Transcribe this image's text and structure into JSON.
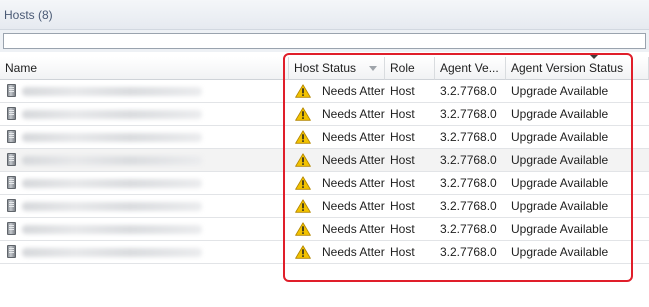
{
  "window": {
    "title": "Hosts (8)"
  },
  "search": {
    "value": "",
    "placeholder": ""
  },
  "columns": {
    "name": "Name",
    "host_status": "Host Status",
    "role": "Role",
    "agent_version": "Agent Ve...",
    "agent_version_status": "Agent Version Status"
  },
  "rows": [
    {
      "host_status": "Needs Atter",
      "role": "Host",
      "agent_version": "3.2.7768.0",
      "agent_version_status": "Upgrade Available"
    },
    {
      "host_status": "Needs Atter",
      "role": "Host",
      "agent_version": "3.2.7768.0",
      "agent_version_status": "Upgrade Available"
    },
    {
      "host_status": "Needs Atter",
      "role": "Host",
      "agent_version": "3.2.7768.0",
      "agent_version_status": "Upgrade Available"
    },
    {
      "host_status": "Needs Atter",
      "role": "Host",
      "agent_version": "3.2.7768.0",
      "agent_version_status": "Upgrade Available"
    },
    {
      "host_status": "Needs Atter",
      "role": "Host",
      "agent_version": "3.2.7768.0",
      "agent_version_status": "Upgrade Available"
    },
    {
      "host_status": "Needs Atter",
      "role": "Host",
      "agent_version": "3.2.7768.0",
      "agent_version_status": "Upgrade Available"
    },
    {
      "host_status": "Needs Atter",
      "role": "Host",
      "agent_version": "3.2.7768.0",
      "agent_version_status": "Upgrade Available"
    },
    {
      "host_status": "Needs Atter",
      "role": "Host",
      "agent_version": "3.2.7768.0",
      "agent_version_status": "Upgrade Available"
    }
  ],
  "icons": {
    "host": "server-icon",
    "status": "warning-icon"
  },
  "colors": {
    "highlight": "#e01e2a",
    "warning": "#f2c200"
  }
}
